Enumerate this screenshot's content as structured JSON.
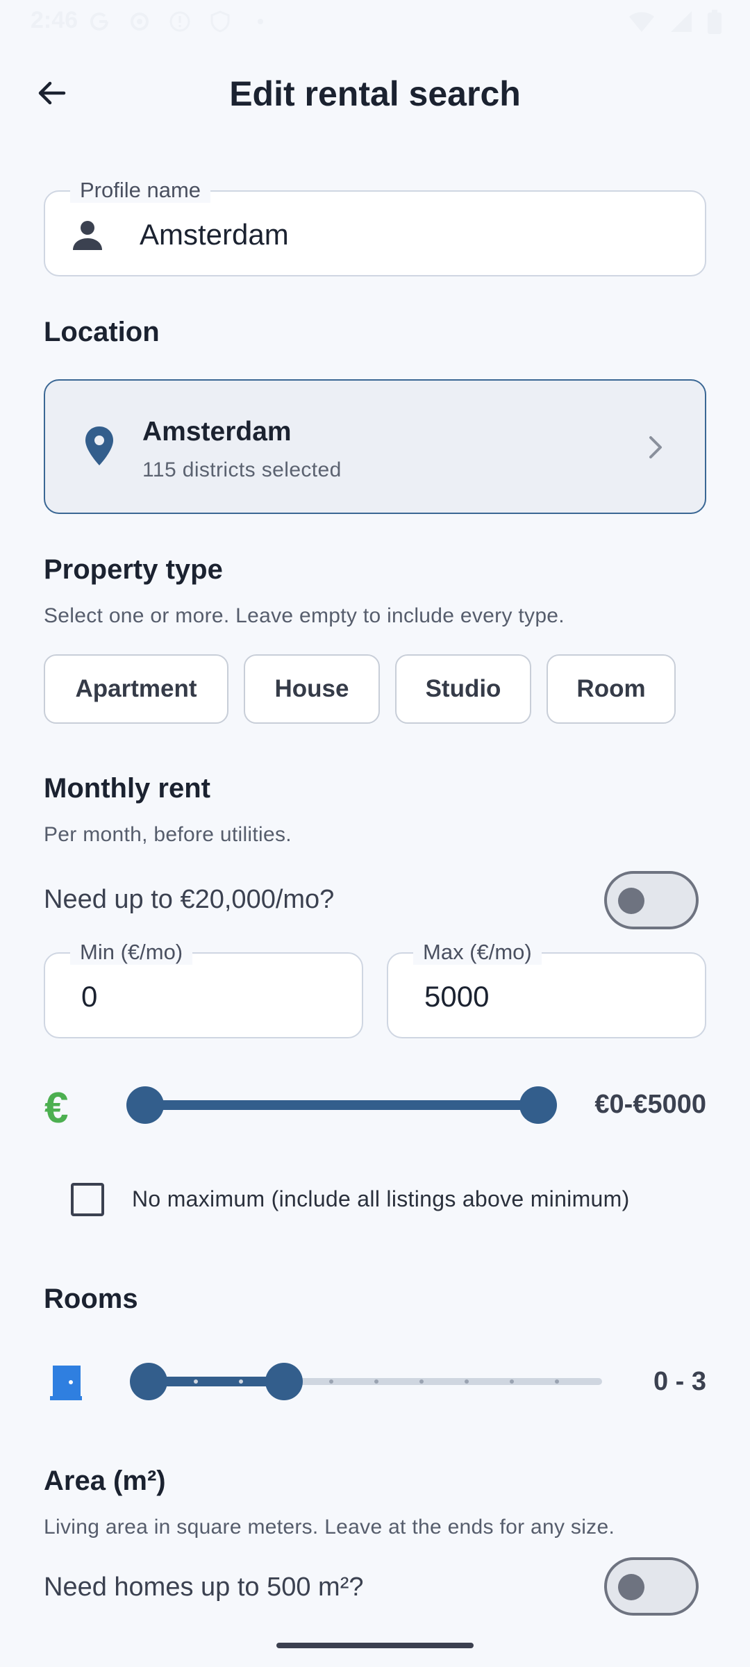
{
  "status_bar": {
    "time": "2:46",
    "left_icons": [
      "google-icon",
      "settings-icon",
      "info-icon",
      "shield-icon",
      "dot-icon"
    ],
    "right_icons": [
      "wifi-icon",
      "signal-icon",
      "battery-icon"
    ]
  },
  "header": {
    "title": "Edit rental search",
    "back_icon": "arrow-back-icon"
  },
  "profile": {
    "label": "Profile name",
    "value": "Amsterdam",
    "icon": "person-icon"
  },
  "location": {
    "section_title": "Location",
    "city": "Amsterdam",
    "districts": "115 districts selected",
    "icon": "location-pin-icon"
  },
  "property_type": {
    "section_title": "Property type",
    "subtitle": "Select one or more. Leave empty to include every type.",
    "options": [
      "Apartment",
      "House",
      "Studio",
      "Room"
    ]
  },
  "monthly_rent": {
    "section_title": "Monthly rent",
    "subtitle": "Per month, before utilities.",
    "toggle_label": "Need up to €20,000/mo?",
    "toggle_on": false,
    "min_label": "Min (€/mo)",
    "min_value": "0",
    "max_label": "Max (€/mo)",
    "max_value": "5000",
    "currency_symbol": "€",
    "slider_range_text": "€0-€5000",
    "slider_min": 0,
    "slider_max": 5000,
    "no_max_label": "No maximum (include all listings above minimum)",
    "no_max_checked": false
  },
  "rooms": {
    "section_title": "Rooms",
    "range_text": "0 - 3",
    "min": 0,
    "max": 3,
    "steps": 10,
    "icon": "door-icon"
  },
  "area": {
    "section_title": "Area (m²)",
    "subtitle": "Living area in square meters. Leave at the ends for any size.",
    "toggle_label": "Need homes up to 500 m²?",
    "toggle_on": false
  },
  "colors": {
    "accent": "#335e8c",
    "euro_green": "#4caf50",
    "door_blue": "#2f7fe0",
    "background": "#f6f8fc"
  }
}
